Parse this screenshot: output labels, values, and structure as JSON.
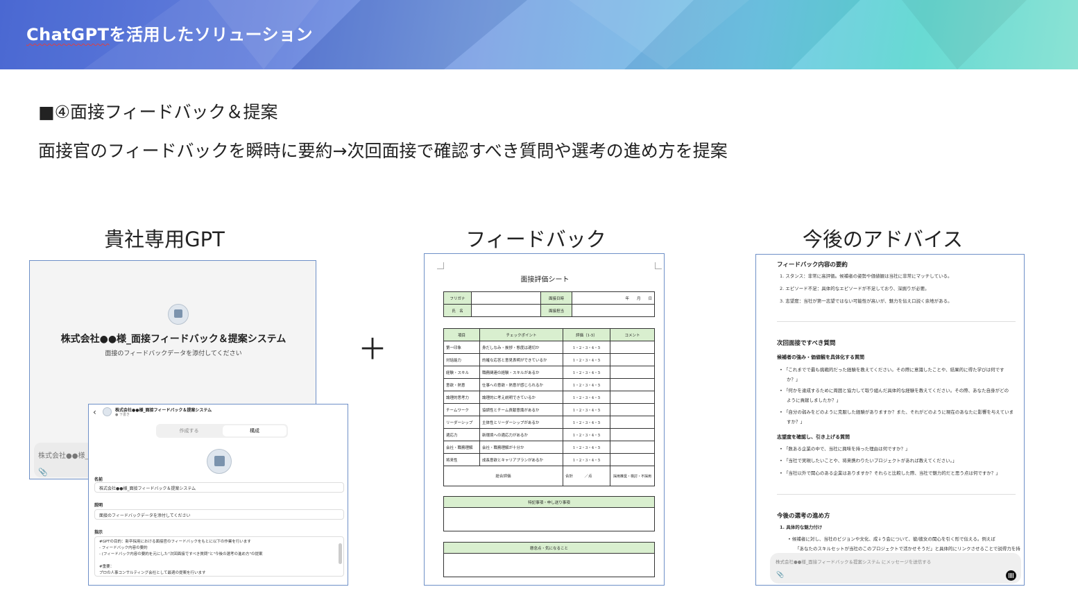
{
  "banner": {
    "title_a": "ChatGPT",
    "title_b": "を活用したソリューション"
  },
  "heading": "■④面接フィードバック＆提案",
  "subline": "面接官のフィードバックを瞬時に要約→次回面接で確認すべき質問や選考の進め方を提案",
  "columns": {
    "gpt": "貴社専用GPT",
    "feedback": "フィードバック",
    "advice": "今後のアドバイス"
  },
  "plus": "＋",
  "gpt_panel": {
    "title": "株式会社●●様_面接フィードバック＆提案システム",
    "subtitle": "面接のフィードバックデータを添付してください",
    "input_placeholder": "株式会社●●様_面"
  },
  "config_panel": {
    "back": "‹",
    "title": "株式会社●●様_面接フィードバック＆提案システム",
    "status": "● 下書き",
    "tab_create": "作成する",
    "tab_config": "構成",
    "name_label": "名前",
    "name_value": "株式会社●●様_面接フィードバック＆提案システム",
    "desc_label": "説明",
    "desc_value": "面接のフィードバックデータを添付してください",
    "instr_label": "指示",
    "instructions": [
      "#GPTの目的：新卒採用における面接官のフィードバックをもとに以下の作業を行います",
      "- フィードバック内容の要約",
      "- (フィードバック内容の要約を元にした\"次回面接ですべき質問\"と\"今後の選考の進め方\"の提案",
      "",
      "#重要：",
      "プロの人事コンサルティング会社として最適の提案を行います"
    ]
  },
  "sheet": {
    "title": "面接評価シート",
    "furigana": "フリガナ",
    "name": "氏　名",
    "date_label": "面接日時",
    "date_value": "年　　月　　日",
    "interviewer": "面接担当",
    "headers": [
      "項目",
      "チェックポイント",
      "評価（1-5）",
      "コメント"
    ],
    "rows": [
      [
        "第一印象",
        "身だしなみ・挨拶・態度は適切か"
      ],
      [
        "対話能力",
        "的確な応答と意見表明ができているか"
      ],
      [
        "経験・スキル",
        "職務関連の経験・スキルがあるか"
      ],
      [
        "意欲・熱意",
        "仕事への意欲・熱意が感じられるか"
      ],
      [
        "論理的思考力",
        "論理的に考え説明できているか"
      ],
      [
        "チームワーク",
        "協調性とチーム貢献意識があるか"
      ],
      [
        "リーダーシップ",
        "主体性とリーダーシップがあるか"
      ],
      [
        "適応力",
        "新環境への適応力があるか"
      ],
      [
        "会社・職務理解",
        "会社・職務理解が十分か"
      ],
      [
        "将来性",
        "成長意欲とキャリアプランがあるか"
      ]
    ],
    "scale": "1・2・3・4・5",
    "total_label": "総合評価",
    "sum_label": "合計　　　／点",
    "decision": "採用推奨・検討・不採用",
    "notes": "特記事項・申し送り事項",
    "concerns": "懸念点・気になること"
  },
  "advice": {
    "summary_title": "フィードバック内容の要約",
    "summary": [
      "1.  スタンス：非常に高評価。候補者の姿勢や価値観は当社に非常にマッチしている。",
      "2.  エピソード不足：具体的なエピソードが不足しており、深掘りが必要。",
      "3.  志望度：当社が第一志望ではない可能性が高いが、魅力を伝え口説く余地がある。"
    ],
    "next_title": "次回面接ですべき質問",
    "q1_title": "候補者の強み・価値観を具体化する質問",
    "q1": [
      "•  「これまでで最も挑戦的だった経験を教えてください。その際に意識したことや、結果的に得た学びは何です",
      "か？」",
      "•  「何かを達成するために周囲と協力して取り組んだ具体的な経験を教えてください。その際、あなた自身がどの",
      "ように貢献しましたか？」",
      "•  「自分の弱みをどのように克服した経験がありますか？また、それがどのように現在のあなたに影響を与えていま",
      "すか？」"
    ],
    "q2_title": "志望度を確認し、引き上げる質問",
    "q2": [
      "•  「数ある企業の中で、当社に興味を持った理由は何ですか？」",
      "•  「当社で実現したいことや、将来携わりたいプロジェクトがあれば教えてください。」",
      "•  「当社以外で関心のある企業はありますか？それらと比較した際、当社で魅力的だと思う点は何ですか？」"
    ],
    "process_title": "今後の選考の進め方",
    "process_sub": "1.  具体的な魅力付け",
    "process": [
      "•  候補者に対し、当社のビジョンや文化、成↓う会について、彼/彼女の関心を引く形で伝える。例えば",
      "「あなたのスキルセットが当社のこのプロジェクトで活かせそうだ」と具体的にリンクさせることで説得力を持"
    ],
    "message_placeholder": "株式会社●●様_面接フィードバック＆提案システム にメッセージを送信する"
  },
  "icons": {
    "attach": "paperclip-icon",
    "voice": "voice-icon",
    "back": "back-arrow-icon"
  }
}
